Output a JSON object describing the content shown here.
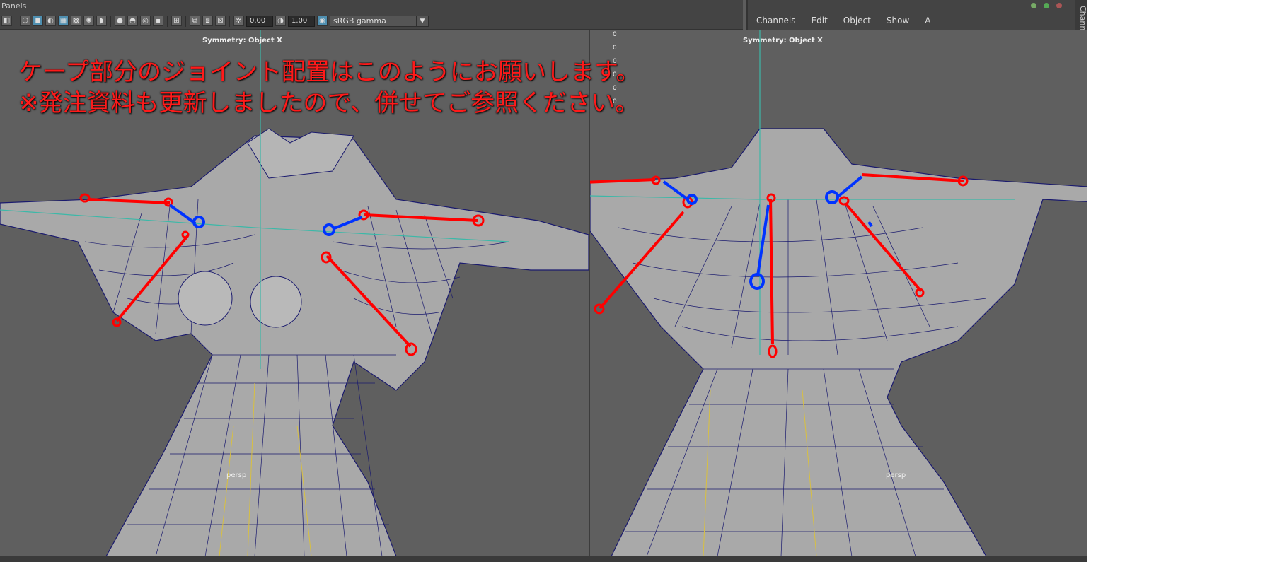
{
  "menu": {
    "panels_label": "Panels"
  },
  "toolbar": {
    "exposure_value": "0.00",
    "gamma_value": "1.00",
    "color_space": "sRGB gamma"
  },
  "channel_box": {
    "menu": [
      "Channels",
      "Edit",
      "Object",
      "Show",
      "A"
    ],
    "side_label": "Channe"
  },
  "viewport_left": {
    "symmetry_label": "Symmetry: Object X",
    "camera_label": "persp"
  },
  "viewport_right": {
    "symmetry_label": "Symmetry: Object X",
    "camera_label": "persp"
  },
  "channel_values": [
    "0",
    "0",
    "0",
    "0",
    "0",
    "0"
  ],
  "annotation": {
    "line1": "ケープ部分のジョイント配置はこのようにお願いします。",
    "line2": "※発注資料も更新しましたので、併せてご参照ください。"
  },
  "colors": {
    "annotation": "#ff1a1a",
    "joint_red": "#ff0000",
    "joint_blue": "#0033ff",
    "wire": "#1a1a6e"
  }
}
